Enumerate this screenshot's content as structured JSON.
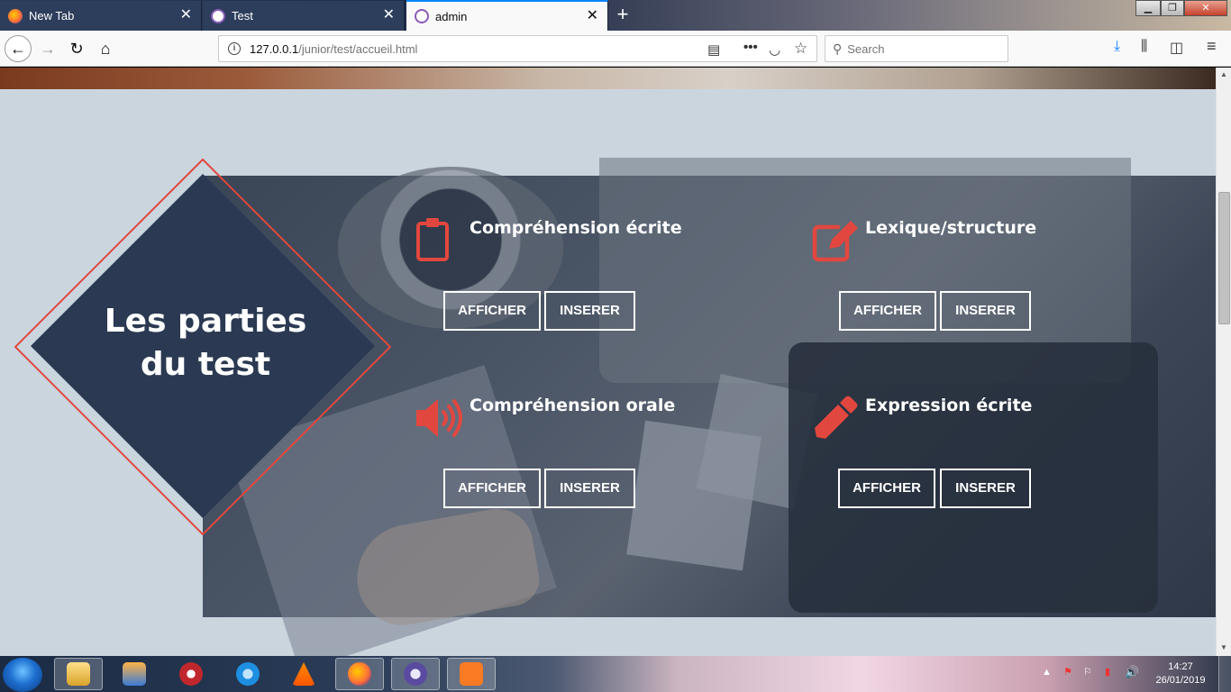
{
  "browser": {
    "tabs": [
      {
        "label": "New Tab",
        "active": false
      },
      {
        "label": "Test",
        "active": false
      },
      {
        "label": "admin",
        "active": true
      }
    ],
    "new_tab_label": "+",
    "url_host": "127.0.0.1",
    "url_path": "/junior/test/accueil.html",
    "search_placeholder": "Search"
  },
  "page": {
    "heading_line1": "Les parties",
    "heading_line2": "du test",
    "accent_color": "#e2473f",
    "sections": [
      {
        "title": "Compréhension écrite",
        "icon": "clipboard-icon",
        "afficher": "AFFICHER",
        "inserer": "INSERER"
      },
      {
        "title": "Lexique/structure",
        "icon": "edit-icon",
        "afficher": "AFFICHER",
        "inserer": "INSERER"
      },
      {
        "title": "Compréhension orale",
        "icon": "speaker-icon",
        "afficher": "AFFICHER",
        "inserer": "INSERER"
      },
      {
        "title": "Expression écrite",
        "icon": "pen-icon",
        "afficher": "AFFICHER",
        "inserer": "INSERER"
      }
    ]
  },
  "taskbar": {
    "time": "14:27",
    "date": "26/01/2019"
  }
}
